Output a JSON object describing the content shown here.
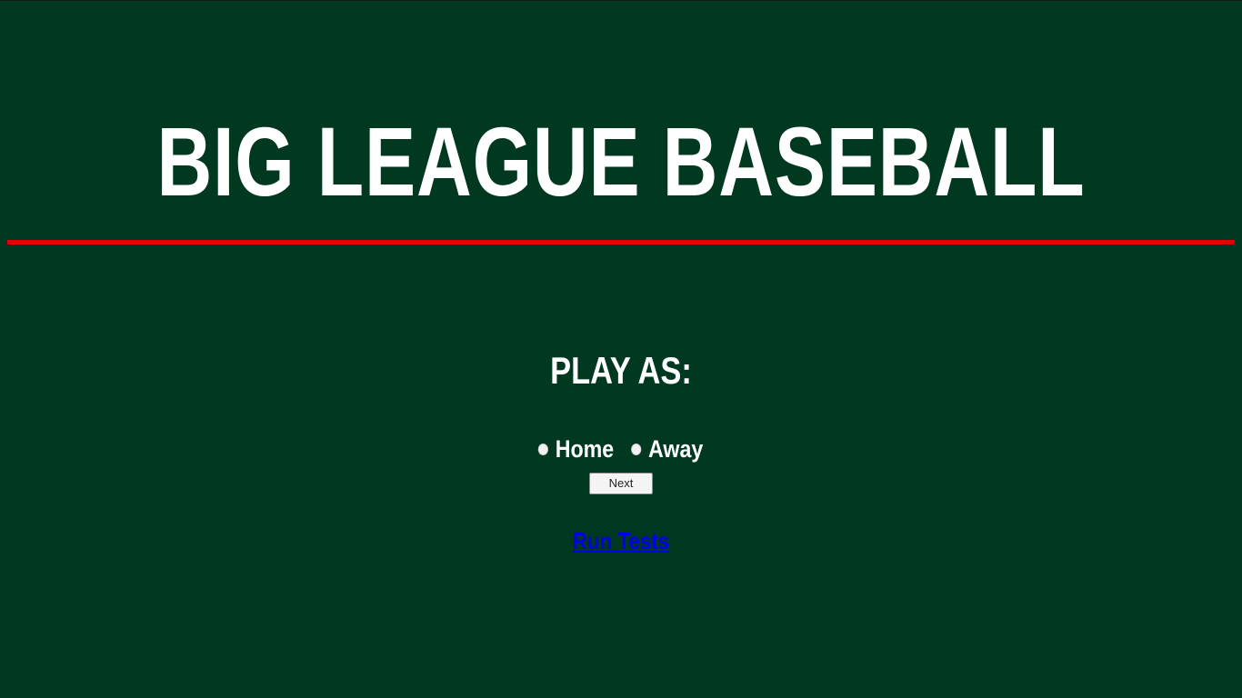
{
  "header": {
    "title": "BIG LEAGUE BASEBALL"
  },
  "main": {
    "subtitle": "PLAY AS:",
    "options": [
      {
        "label": "Home",
        "selected": false
      },
      {
        "label": "Away",
        "selected": false
      }
    ],
    "next_label": "Next",
    "run_tests_label": "Run Tests"
  },
  "colors": {
    "background": "#003820",
    "divider": "#e50000",
    "text": "#ffffff",
    "link": "#0000ee"
  }
}
